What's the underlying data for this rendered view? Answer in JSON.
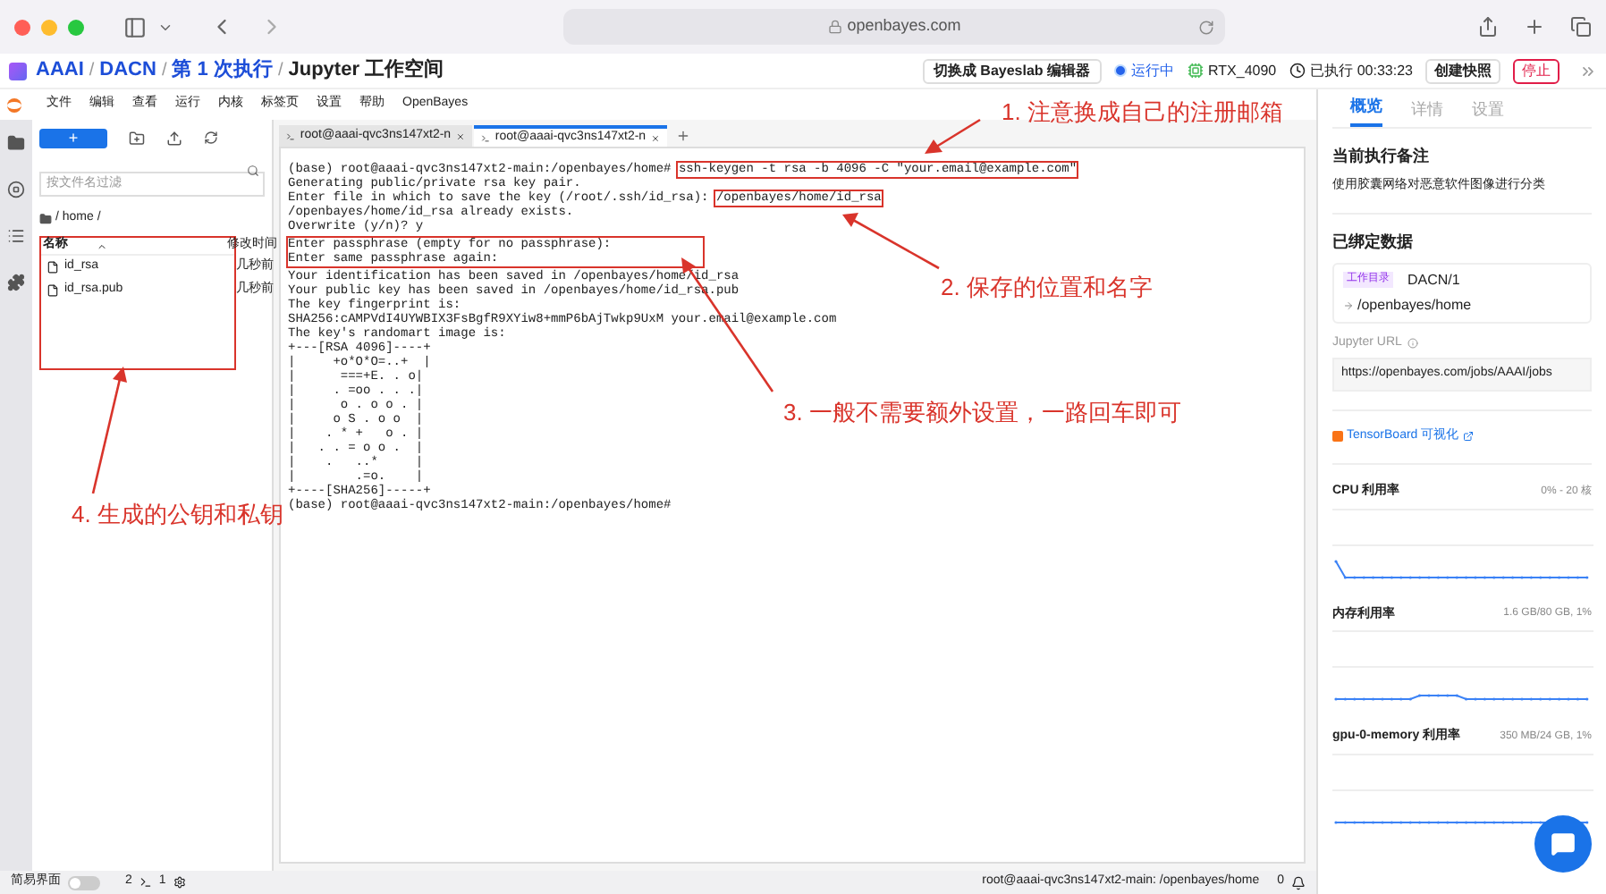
{
  "browser": {
    "url": "openbayes.com"
  },
  "header": {
    "separator": "/",
    "breadcrumb": [
      {
        "label": "AAAI",
        "current": false
      },
      {
        "label": "DACN",
        "current": false
      },
      {
        "label": "第 1 次执行",
        "current": false
      },
      {
        "label": "Jupyter 工作空间",
        "current": true
      }
    ],
    "switch_button": "切换成 Bayeslab 编辑器",
    "status": "运行中",
    "gpu": "RTX_4090",
    "elapsed": "已执行 00:33:23",
    "snapshot_button": "创建快照",
    "stop_button": "停止"
  },
  "menu": [
    "文件",
    "编辑",
    "查看",
    "运行",
    "内核",
    "标签页",
    "设置",
    "帮助",
    "OpenBayes"
  ],
  "file_browser": {
    "new_button": "+",
    "filter": {
      "placeholder": "按文件名过滤"
    },
    "path": "/ home /",
    "columns": [
      "名称",
      "修改时间"
    ],
    "boxed": true,
    "files": [
      {
        "name": "id_rsa",
        "modified": "几秒前"
      },
      {
        "name": "id_rsa.pub",
        "modified": "几秒前"
      }
    ]
  },
  "terminal": {
    "tabs": [
      {
        "label": "root@aaai-qvc3ns147xt2-n",
        "selected": false
      },
      {
        "label": "root@aaai-qvc3ns147xt2-n",
        "selected": true
      }
    ],
    "lines": [
      {
        "kind": "line",
        "parts": [
          {
            "text": "(base) root@aaai-qvc3ns147xt2-main:/openbayes/home# ",
            "boxed": false
          },
          {
            "text": "ssh-keygen -t rsa -b 4096 -C \"your.email@example.com\"",
            "boxed": true
          }
        ]
      },
      {
        "kind": "line",
        "parts": [
          {
            "text": "Generating public/private rsa key pair.",
            "boxed": false
          }
        ]
      },
      {
        "kind": "line",
        "parts": [
          {
            "text": "Enter file in which to save the key (/root/.ssh/id_rsa): ",
            "boxed": false
          },
          {
            "text": "/openbayes/home/id_rsa",
            "boxed": true
          }
        ]
      },
      {
        "kind": "line",
        "parts": [
          {
            "text": "/openbayes/home/id_rsa already exists.",
            "boxed": false
          }
        ]
      },
      {
        "kind": "line",
        "parts": [
          {
            "text": "Overwrite (y/n)? y",
            "boxed": false
          }
        ]
      },
      {
        "kind": "group",
        "boxed": true,
        "lines": [
          "Enter passphrase (empty for no passphrase):",
          "Enter same passphrase again:"
        ]
      },
      {
        "kind": "line",
        "parts": [
          {
            "text": "Your identification has been saved in /openbayes/home/id_rsa",
            "boxed": false
          }
        ]
      },
      {
        "kind": "line",
        "parts": [
          {
            "text": "Your public key has been saved in /openbayes/home/id_rsa.pub",
            "boxed": false
          }
        ]
      },
      {
        "kind": "line",
        "parts": [
          {
            "text": "The key fingerprint is:",
            "boxed": false
          }
        ]
      },
      {
        "kind": "line",
        "parts": [
          {
            "text": "SHA256:cAMPVdI4UYWBIX3FsBgfR9XYiw8+mmP6bAjTwkp9UxM your.email@example.com",
            "boxed": false
          }
        ]
      },
      {
        "kind": "line",
        "parts": [
          {
            "text": "The key's randomart image is:",
            "boxed": false
          }
        ]
      },
      {
        "kind": "line",
        "parts": [
          {
            "text": "+---[RSA 4096]----+",
            "boxed": false
          }
        ]
      },
      {
        "kind": "line",
        "parts": [
          {
            "text": "|     +o*O*O=..+  |",
            "boxed": false
          }
        ]
      },
      {
        "kind": "line",
        "parts": [
          {
            "text": "|      ===+E. . o|",
            "boxed": false
          }
        ]
      },
      {
        "kind": "line",
        "parts": [
          {
            "text": "|     . =oo . . .|",
            "boxed": false
          }
        ]
      },
      {
        "kind": "line",
        "parts": [
          {
            "text": "|      o . o o . |",
            "boxed": false
          }
        ]
      },
      {
        "kind": "line",
        "parts": [
          {
            "text": "|     o S . o o  |",
            "boxed": false
          }
        ]
      },
      {
        "kind": "line",
        "parts": [
          {
            "text": "|    . * +   o . |",
            "boxed": false
          }
        ]
      },
      {
        "kind": "line",
        "parts": [
          {
            "text": "|   . . = o o .  |",
            "boxed": false
          }
        ]
      },
      {
        "kind": "line",
        "parts": [
          {
            "text": "|    .   ..*     |",
            "boxed": false
          }
        ]
      },
      {
        "kind": "line",
        "parts": [
          {
            "text": "|        .=o.    |",
            "boxed": false
          }
        ]
      },
      {
        "kind": "line",
        "parts": [
          {
            "text": "+----[SHA256]-----+",
            "boxed": false
          }
        ]
      },
      {
        "kind": "line",
        "parts": [
          {
            "text": "(base) root@aaai-qvc3ns147xt2-main:/openbayes/home#",
            "boxed": false
          }
        ]
      }
    ]
  },
  "annotations": [
    {
      "text": "1. 注意换成自己的注册邮箱"
    },
    {
      "text": "2. 保存的位置和名字"
    },
    {
      "text": "3. 一般不需要额外设置，一路回车即可"
    },
    {
      "text": "4. 生成的公钥和私钥"
    }
  ],
  "status_bar": {
    "simple_mode": {
      "label": "简易界面",
      "on": false
    },
    "terminals": "2",
    "kernels": "1",
    "path": "root@aaai-qvc3ns147xt2-main: /openbayes/home",
    "notifications": "0"
  },
  "side_panel": {
    "tabs": [
      {
        "label": "概览",
        "selected": true
      },
      {
        "label": "详情",
        "selected": false
      },
      {
        "label": "设置",
        "selected": false
      }
    ],
    "note_title": "当前执行备注",
    "note": "使用胶囊网络对恶意软件图像进行分类",
    "data_title": "已绑定数据",
    "data": {
      "tag": "工作目录",
      "name": "DACN/1",
      "mount": "/openbayes/home"
    },
    "url_label": "Jupyter URL",
    "url": "https://openbayes.com/jobs/AAAI/jobs",
    "tensorboard": "TensorBoard 可视化",
    "metrics": [
      {
        "name": "CPU 利用率",
        "reading": "0% - 20 核"
      },
      {
        "name": "内存利用率",
        "reading": "1.6 GB/80 GB, 1%"
      },
      {
        "name": "gpu-0-memory 利用率",
        "reading": "350 MB/24 GB, 1%"
      }
    ]
  }
}
